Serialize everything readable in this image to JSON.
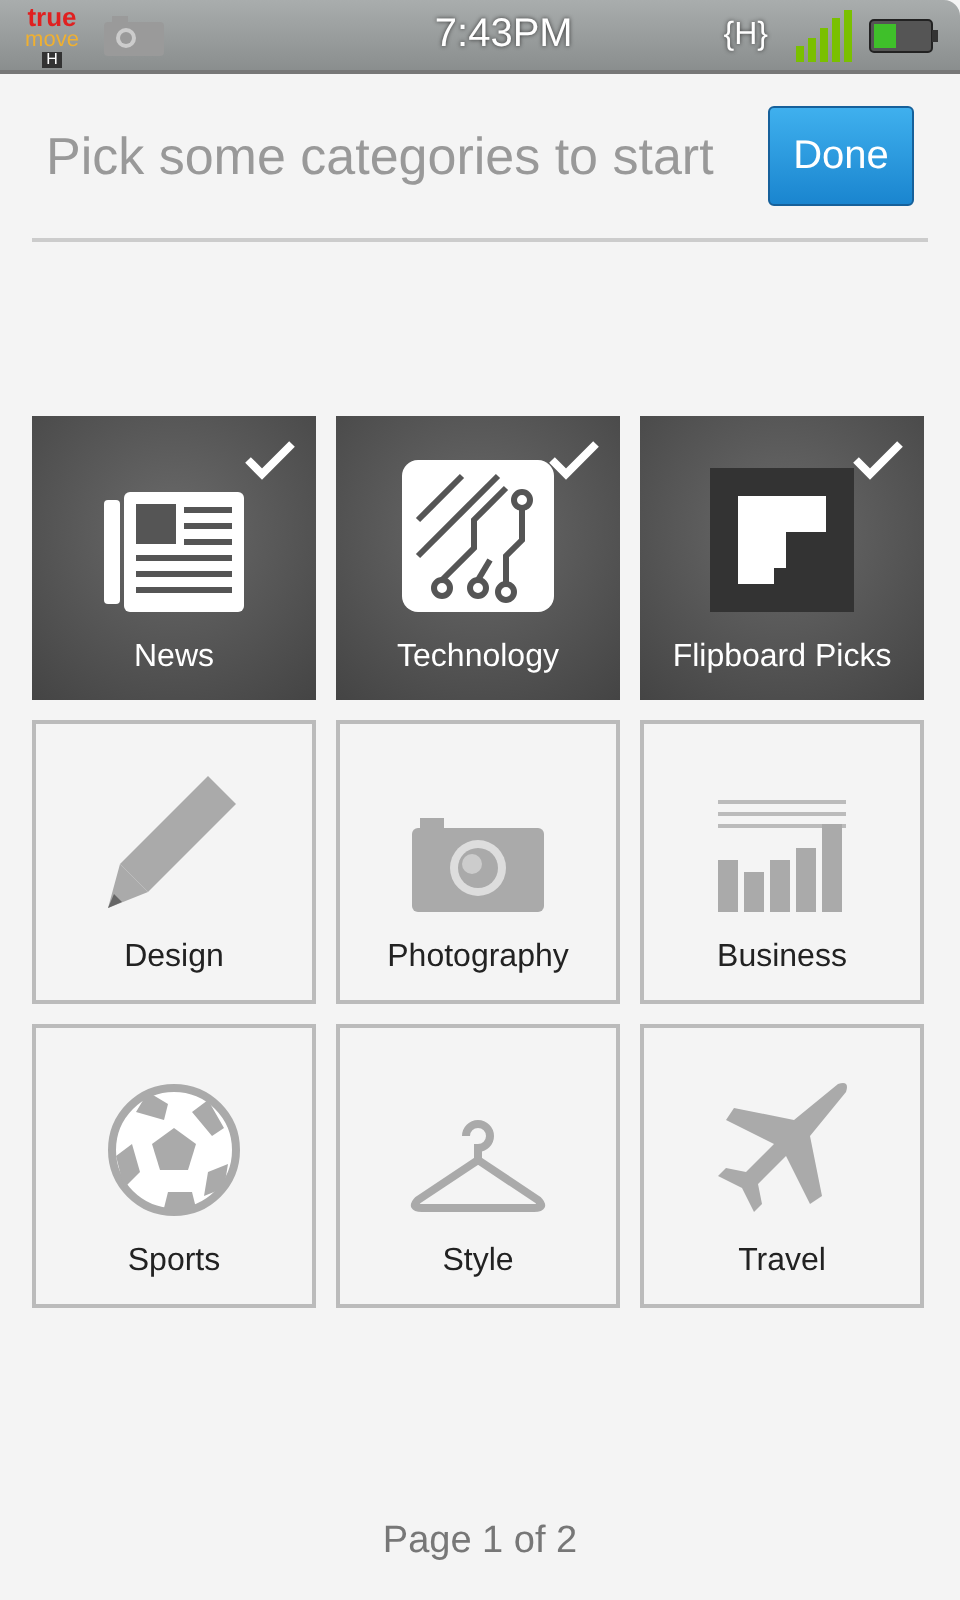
{
  "status_bar": {
    "carrier": [
      "true",
      "move",
      "H"
    ],
    "time": "7:43PM",
    "network": "{H}"
  },
  "header": {
    "title": "Pick some categories to start",
    "done_button": "Done"
  },
  "categories": [
    {
      "label": "News",
      "selected": true
    },
    {
      "label": "Technology",
      "selected": true
    },
    {
      "label": "Flipboard Picks",
      "selected": true
    },
    {
      "label": "Design",
      "selected": false
    },
    {
      "label": "Photography",
      "selected": false
    },
    {
      "label": "Business",
      "selected": false
    },
    {
      "label": "Sports",
      "selected": false
    },
    {
      "label": "Style",
      "selected": false
    },
    {
      "label": "Travel",
      "selected": false
    }
  ],
  "pager": "Page 1 of 2"
}
